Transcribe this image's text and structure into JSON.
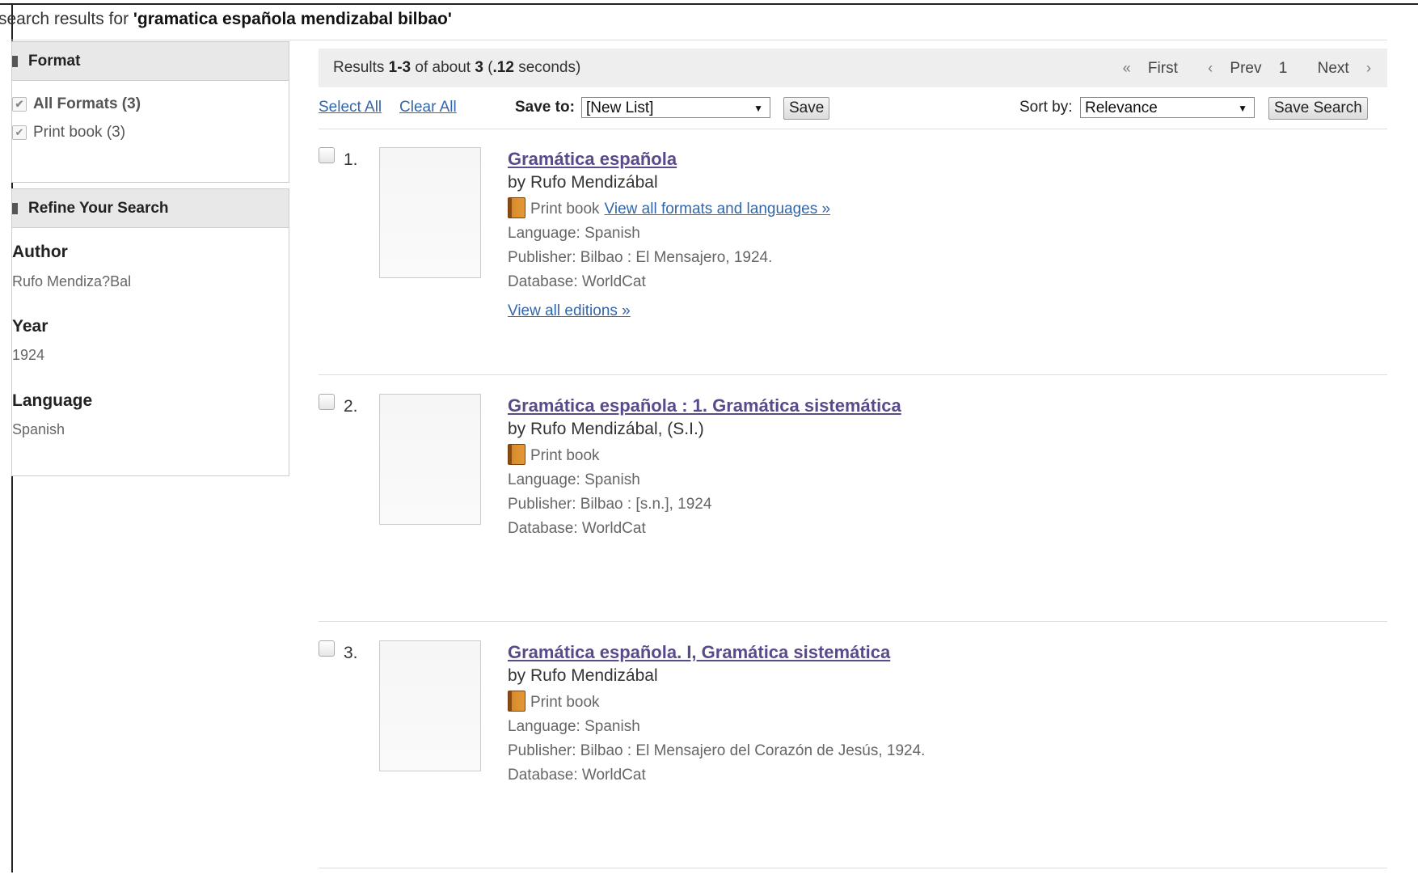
{
  "heading": {
    "prefix": "search results for ",
    "query": "'gramatica española mendizabal bilbao'"
  },
  "sidebar": {
    "format": {
      "title": "Format",
      "items": [
        {
          "label": "All Formats (3)",
          "checked": true
        },
        {
          "label": "Print book (3)",
          "checked": true
        }
      ]
    },
    "refine": {
      "title": "Refine Your Search",
      "groups": [
        {
          "label": "Author",
          "value": "Rufo Mendiza?Bal"
        },
        {
          "label": "Year",
          "value": "1924"
        },
        {
          "label": "Language",
          "value": "Spanish"
        }
      ]
    }
  },
  "results_bar": {
    "prefix": "Results ",
    "range": "1-3",
    "of_about": " of about ",
    "total": "3",
    "time_open": " (",
    "time": ".12",
    "time_close": " seconds)",
    "pager": {
      "first": "First",
      "prev": "Prev",
      "page": "1",
      "next": "Next"
    }
  },
  "toolbar": {
    "select_all": "Select All",
    "clear_all": "Clear All",
    "save_to_label": "Save to:",
    "save_to_value": "[New List]",
    "save_button": "Save",
    "sort_label": "Sort by:",
    "sort_value": "Relevance",
    "save_search_button": "Save Search"
  },
  "results": [
    {
      "num": "1.",
      "title": "Gramática española",
      "author": "by Rufo Mendizábal",
      "format": "Print book",
      "format_link": "View all formats and languages »",
      "language": "Language: Spanish",
      "publisher": "Publisher: Bilbao : El Mensajero, 1924.",
      "database": "Database: WorldCat",
      "editions_link": "View all editions »"
    },
    {
      "num": "2.",
      "title": "Gramática española : 1. Gramática sistemática",
      "author": "by Rufo Mendizábal, (S.I.)",
      "format": "Print book",
      "language": "Language: Spanish",
      "publisher": "Publisher: Bilbao : [s.n.], 1924",
      "database": "Database: WorldCat"
    },
    {
      "num": "3.",
      "title": "Gramática española. I, Gramática sistemática",
      "author": "by Rufo Mendizábal",
      "format": "Print book",
      "language": "Language: Spanish",
      "publisher": "Publisher: Bilbao : El Mensajero del Corazón de Jesús, 1924.",
      "database": "Database: WorldCat"
    }
  ]
}
